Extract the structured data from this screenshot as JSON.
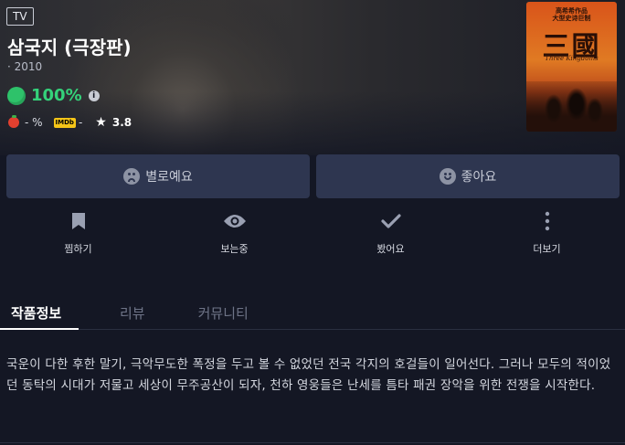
{
  "hero": {
    "badge": "TV",
    "title": "삼국지 (극장판)",
    "meta": "· 2010",
    "score": "100%",
    "tomato_score": "- %",
    "imdb_label": "IMDb",
    "imdb_score": "-",
    "star_rating": "3.8"
  },
  "poster": {
    "top_text_1": "高希希作品",
    "top_text_2": "大型史诗巨制",
    "title_han": "三國",
    "subtitle": "Three Kingdoms"
  },
  "reaction": {
    "dislike_label": "별로예요",
    "like_label": "좋아요"
  },
  "actions": {
    "bookmark_label": "찜하기",
    "watching_label": "보는중",
    "watched_label": "봤어요",
    "more_label": "더보기"
  },
  "tabs": {
    "info": "작품정보",
    "reviews": "리뷰",
    "community": "커뮤니티"
  },
  "description": "국운이 다한 후한 말기, 극악무도한 폭정을 두고 볼 수 없었던 전국 각지의 호걸들이 일어선다. 그러나 모두의 적이었던 동탁의 시대가 저물고 세상이 무주공산이 되자, 천하 영웅들은 난세를 틈타 패권 장악을 위한 전쟁을 시작한다.",
  "colors": {
    "background": "#141724",
    "button": "#2e3650",
    "score_green": "#34d27a",
    "imdb_yellow": "#f5c518"
  }
}
